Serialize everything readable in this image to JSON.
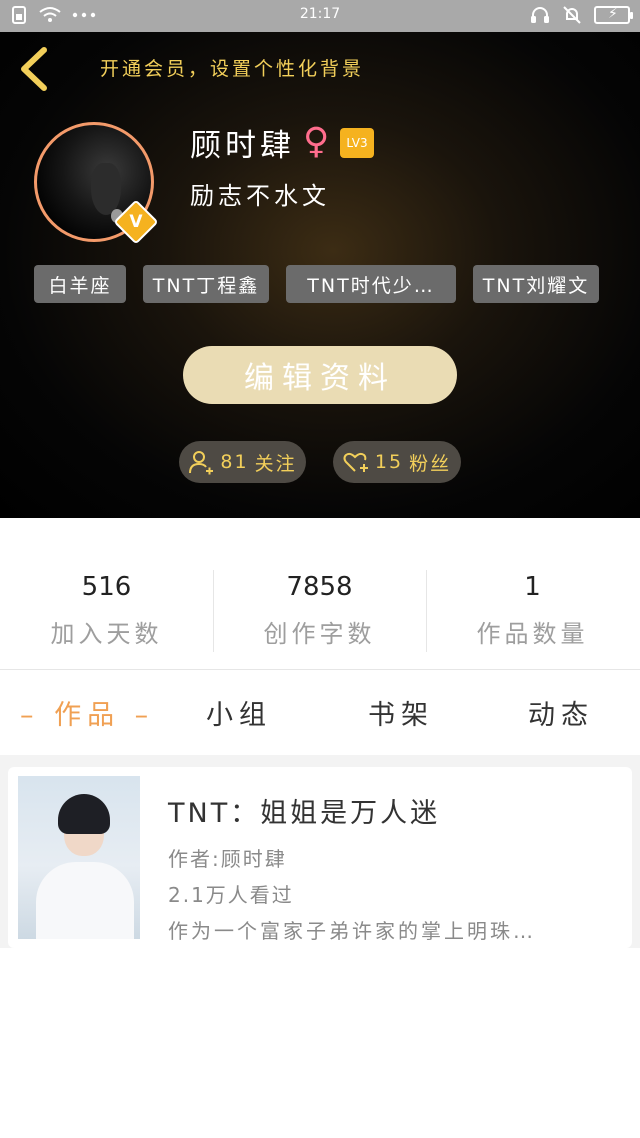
{
  "status_bar": {
    "time": "21:17",
    "left_icons": [
      "sim-icon",
      "wifi-icon",
      "more-dots-icon"
    ],
    "right_icons": [
      "headset-icon",
      "mute-bell-icon",
      "battery-charging-icon"
    ]
  },
  "header": {
    "vip_tip": "开通会员，设置个性化背景",
    "username": "顾时肆",
    "gender_symbol": "♀",
    "level": "LV3",
    "verified_symbol": "V",
    "signature": "励志不水文",
    "tags": [
      "白羊座",
      "TNT丁程鑫",
      "TNT时代少…",
      "TNT刘耀文"
    ],
    "edit_button": "编辑资料",
    "follow_count": "81",
    "follow_label": "关注",
    "fans_count": "15",
    "fans_label": "粉丝"
  },
  "stats": [
    {
      "value": "516",
      "label": "加入天数"
    },
    {
      "value": "7858",
      "label": "创作字数"
    },
    {
      "value": "1",
      "label": "作品数量"
    }
  ],
  "tabs": [
    {
      "label": "– 作品 –",
      "active": true
    },
    {
      "label": "小组",
      "active": false
    },
    {
      "label": "书架",
      "active": false
    },
    {
      "label": "动态",
      "active": false
    }
  ],
  "works": [
    {
      "title": "TNT：姐姐是万人迷",
      "author": "作者:顾时肆",
      "views": "2.1万人看过",
      "description": "作为一个富家子弟许家的掌上明珠…"
    }
  ],
  "colors": {
    "accent_gold": "#f2cf5a",
    "active_tab": "#f0a053",
    "edit_button_bg": "#eadcb4",
    "gender_pink": "#ff6d8d",
    "status_bar_bg": "#a9a9a9"
  }
}
